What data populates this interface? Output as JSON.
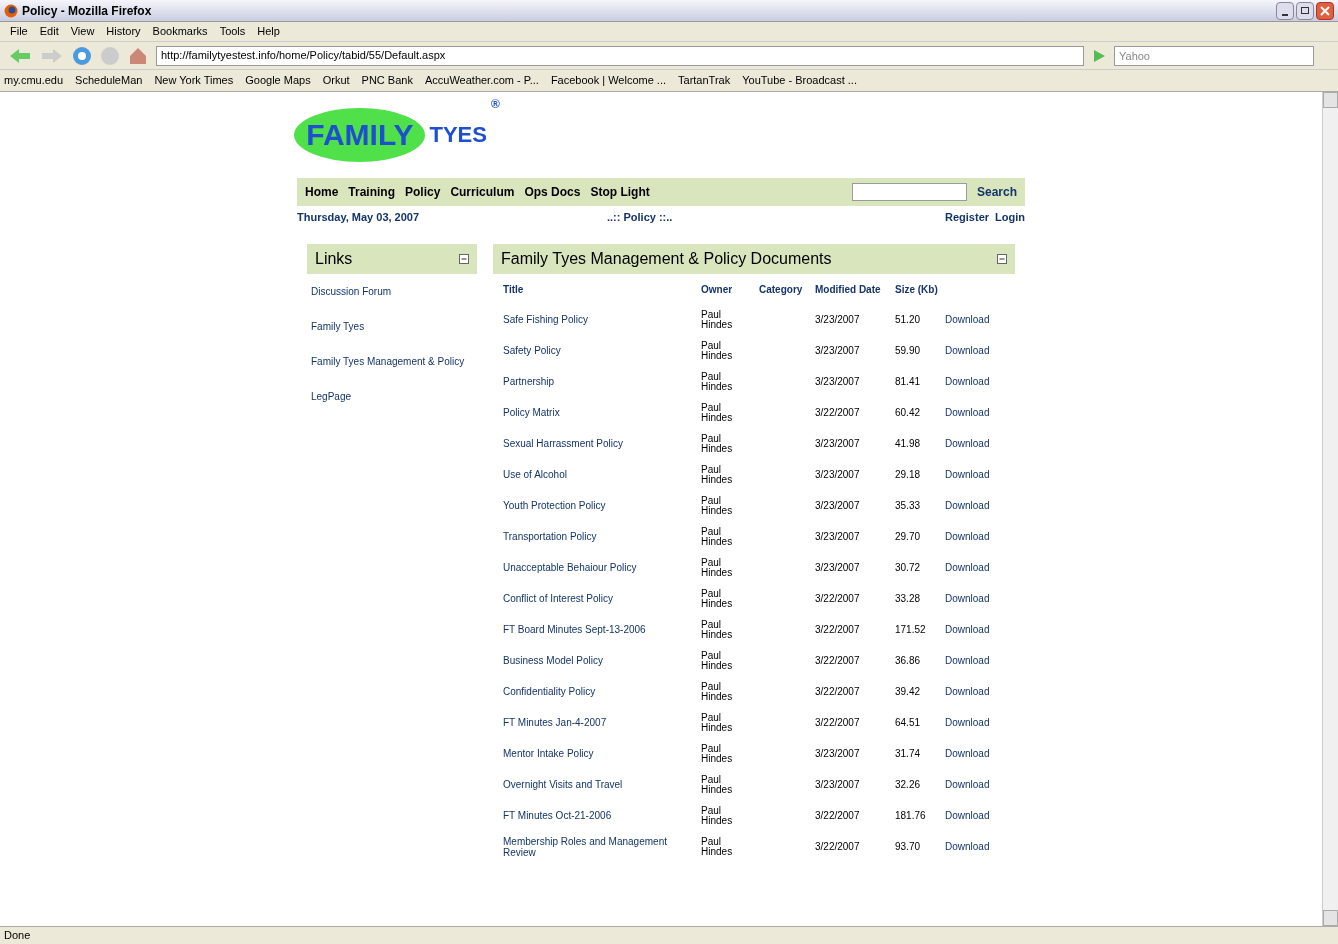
{
  "window": {
    "title": "Policy - Mozilla Firefox"
  },
  "menu": [
    "File",
    "Edit",
    "View",
    "History",
    "Bookmarks",
    "Tools",
    "Help"
  ],
  "address": {
    "value": "http://familytyestest.info/home/Policy/tabid/55/Default.aspx"
  },
  "browser_search": {
    "placeholder": "Yahoo"
  },
  "bookmarks": [
    "my.cmu.edu",
    "ScheduleMan",
    "New York Times",
    "Google Maps",
    "Orkut",
    "PNC Bank",
    "AccuWeather.com - P...",
    "Facebook | Welcome ...",
    "TartanTrak",
    "YouTube - Broadcast ..."
  ],
  "logo": {
    "line1": "FAMILY",
    "line2": "TYES",
    "mark": "®"
  },
  "nav": [
    "Home",
    "Training",
    "Policy",
    "Curriculum",
    "Ops Docs",
    "Stop Light"
  ],
  "site_search": {
    "button": "Search"
  },
  "date": "Thursday, May 03, 2007",
  "breadcrumb": "..:: Policy ::..",
  "account": [
    "Register",
    "Login"
  ],
  "links_panel": {
    "title": "Links",
    "items": [
      "Discussion Forum",
      "Family Tyes",
      "Family Tyes Management & Policy",
      "LegPage"
    ]
  },
  "documents": {
    "title": "Family Tyes Management & Policy Documents",
    "columns": [
      "Title",
      "Owner",
      "Category",
      "Modified Date",
      "Size (Kb)"
    ],
    "rows": [
      {
        "title": "Safe Fishing Policy",
        "owner": "Paul Hindes",
        "date": "3/23/2007",
        "size": "51.20",
        "action": "Download"
      },
      {
        "title": "Safety Policy",
        "owner": "Paul Hindes",
        "date": "3/23/2007",
        "size": "59.90",
        "action": "Download"
      },
      {
        "title": "Partnership",
        "owner": "Paul Hindes",
        "date": "3/23/2007",
        "size": "81.41",
        "action": "Download"
      },
      {
        "title": "Policy Matrix",
        "owner": "Paul Hindes",
        "date": "3/22/2007",
        "size": "60.42",
        "action": "Download"
      },
      {
        "title": "Sexual Harrassment Policy",
        "owner": "Paul Hindes",
        "date": "3/23/2007",
        "size": "41.98",
        "action": "Download"
      },
      {
        "title": "Use of Alcohol",
        "owner": "Paul Hindes",
        "date": "3/23/2007",
        "size": "29.18",
        "action": "Download"
      },
      {
        "title": "Youth Protection Policy",
        "owner": "Paul Hindes",
        "date": "3/23/2007",
        "size": "35.33",
        "action": "Download"
      },
      {
        "title": "Transportation Policy",
        "owner": "Paul Hindes",
        "date": "3/23/2007",
        "size": "29.70",
        "action": "Download"
      },
      {
        "title": "Unacceptable Behaiour Policy",
        "owner": "Paul Hindes",
        "date": "3/23/2007",
        "size": "30.72",
        "action": "Download"
      },
      {
        "title": "Conflict of Interest Policy",
        "owner": "Paul Hindes",
        "date": "3/22/2007",
        "size": "33.28",
        "action": "Download"
      },
      {
        "title": "FT Board Minutes Sept-13-2006",
        "owner": "Paul Hindes",
        "date": "3/22/2007",
        "size": "171.52",
        "action": "Download"
      },
      {
        "title": "Business Model Policy",
        "owner": "Paul Hindes",
        "date": "3/22/2007",
        "size": "36.86",
        "action": "Download"
      },
      {
        "title": "Confidentiality Policy",
        "owner": "Paul Hindes",
        "date": "3/22/2007",
        "size": "39.42",
        "action": "Download"
      },
      {
        "title": "FT Minutes Jan-4-2007",
        "owner": "Paul Hindes",
        "date": "3/22/2007",
        "size": "64.51",
        "action": "Download"
      },
      {
        "title": "Mentor Intake Policy",
        "owner": "Paul Hindes",
        "date": "3/23/2007",
        "size": "31.74",
        "action": "Download"
      },
      {
        "title": "Overnight Visits and Travel",
        "owner": "Paul Hindes",
        "date": "3/23/2007",
        "size": "32.26",
        "action": "Download"
      },
      {
        "title": "FT Minutes Oct-21-2006",
        "owner": "Paul Hindes",
        "date": "3/22/2007",
        "size": "181.76",
        "action": "Download"
      },
      {
        "title": "Membership Roles and Management Review",
        "owner": "Paul Hindes",
        "date": "3/22/2007",
        "size": "93.70",
        "action": "Download"
      }
    ]
  },
  "status_bar": "Done"
}
